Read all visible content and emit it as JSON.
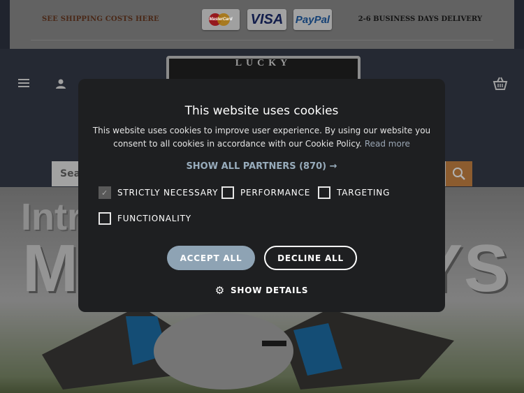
{
  "promo": {
    "left_text": "SEE SHIPPING COSTS HERE",
    "right_text": "2-6 BUSINESS DAYS DELIVERY",
    "payment": {
      "mastercard": "MasterCard",
      "visa": "VISA",
      "paypal": "PayPal"
    }
  },
  "header": {
    "logo_text": "LUCKY",
    "search_placeholder": "Sea"
  },
  "hero": {
    "line1": "Intro",
    "line2": "MO",
    "line2_end": "YS"
  },
  "cookie": {
    "title": "This website uses cookies",
    "description": "This website uses cookies to improve user experience. By using our website you consent to all cookies in accordance with our Cookie Policy.",
    "read_more": "Read more",
    "show_partners": "SHOW ALL PARTNERS (870) →",
    "options": [
      {
        "label": "STRICTLY NECESSARY",
        "checked": true
      },
      {
        "label": "PERFORMANCE",
        "checked": false
      },
      {
        "label": "TARGETING",
        "checked": false
      },
      {
        "label": "FUNCTIONALITY",
        "checked": false
      }
    ],
    "accept": "ACCEPT ALL",
    "decline": "DECLINE ALL",
    "details": "SHOW DETAILS"
  },
  "colors": {
    "accept_bg": "#8ea3b4",
    "search_btn": "#c98544",
    "modal_bg": "#1e1f21"
  }
}
